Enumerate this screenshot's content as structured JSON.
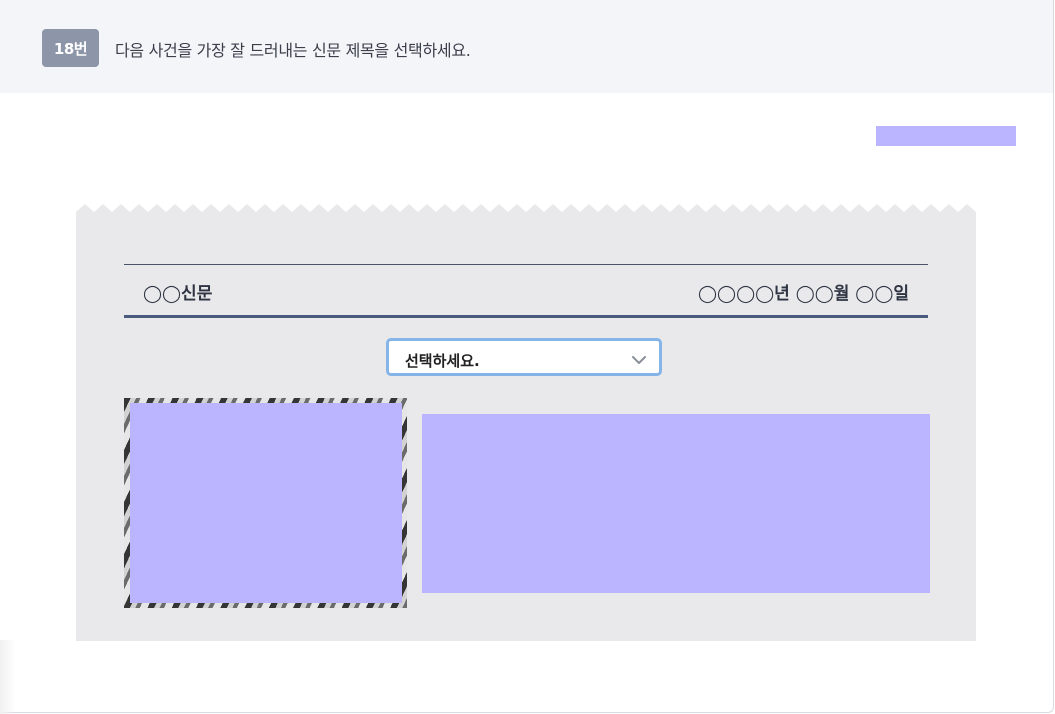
{
  "question": {
    "number_label": "18번",
    "prompt": "다음 사건을 가장 잘 드러내는 신문 제목을 선택하세요."
  },
  "newspaper": {
    "name": "◯◯신문",
    "date": "◯◯◯◯년 ◯◯월 ◯◯일"
  },
  "headline_select": {
    "selected_label": "선택하세요."
  },
  "colors": {
    "header_bg": "#f4f5f9",
    "badge_bg": "#8d96a8",
    "paper_bg": "#e9e9ec",
    "select_border": "#84b4e8",
    "redaction": "#bbb4ff"
  },
  "icons": {
    "select_arrow": "chevron-down-icon"
  }
}
